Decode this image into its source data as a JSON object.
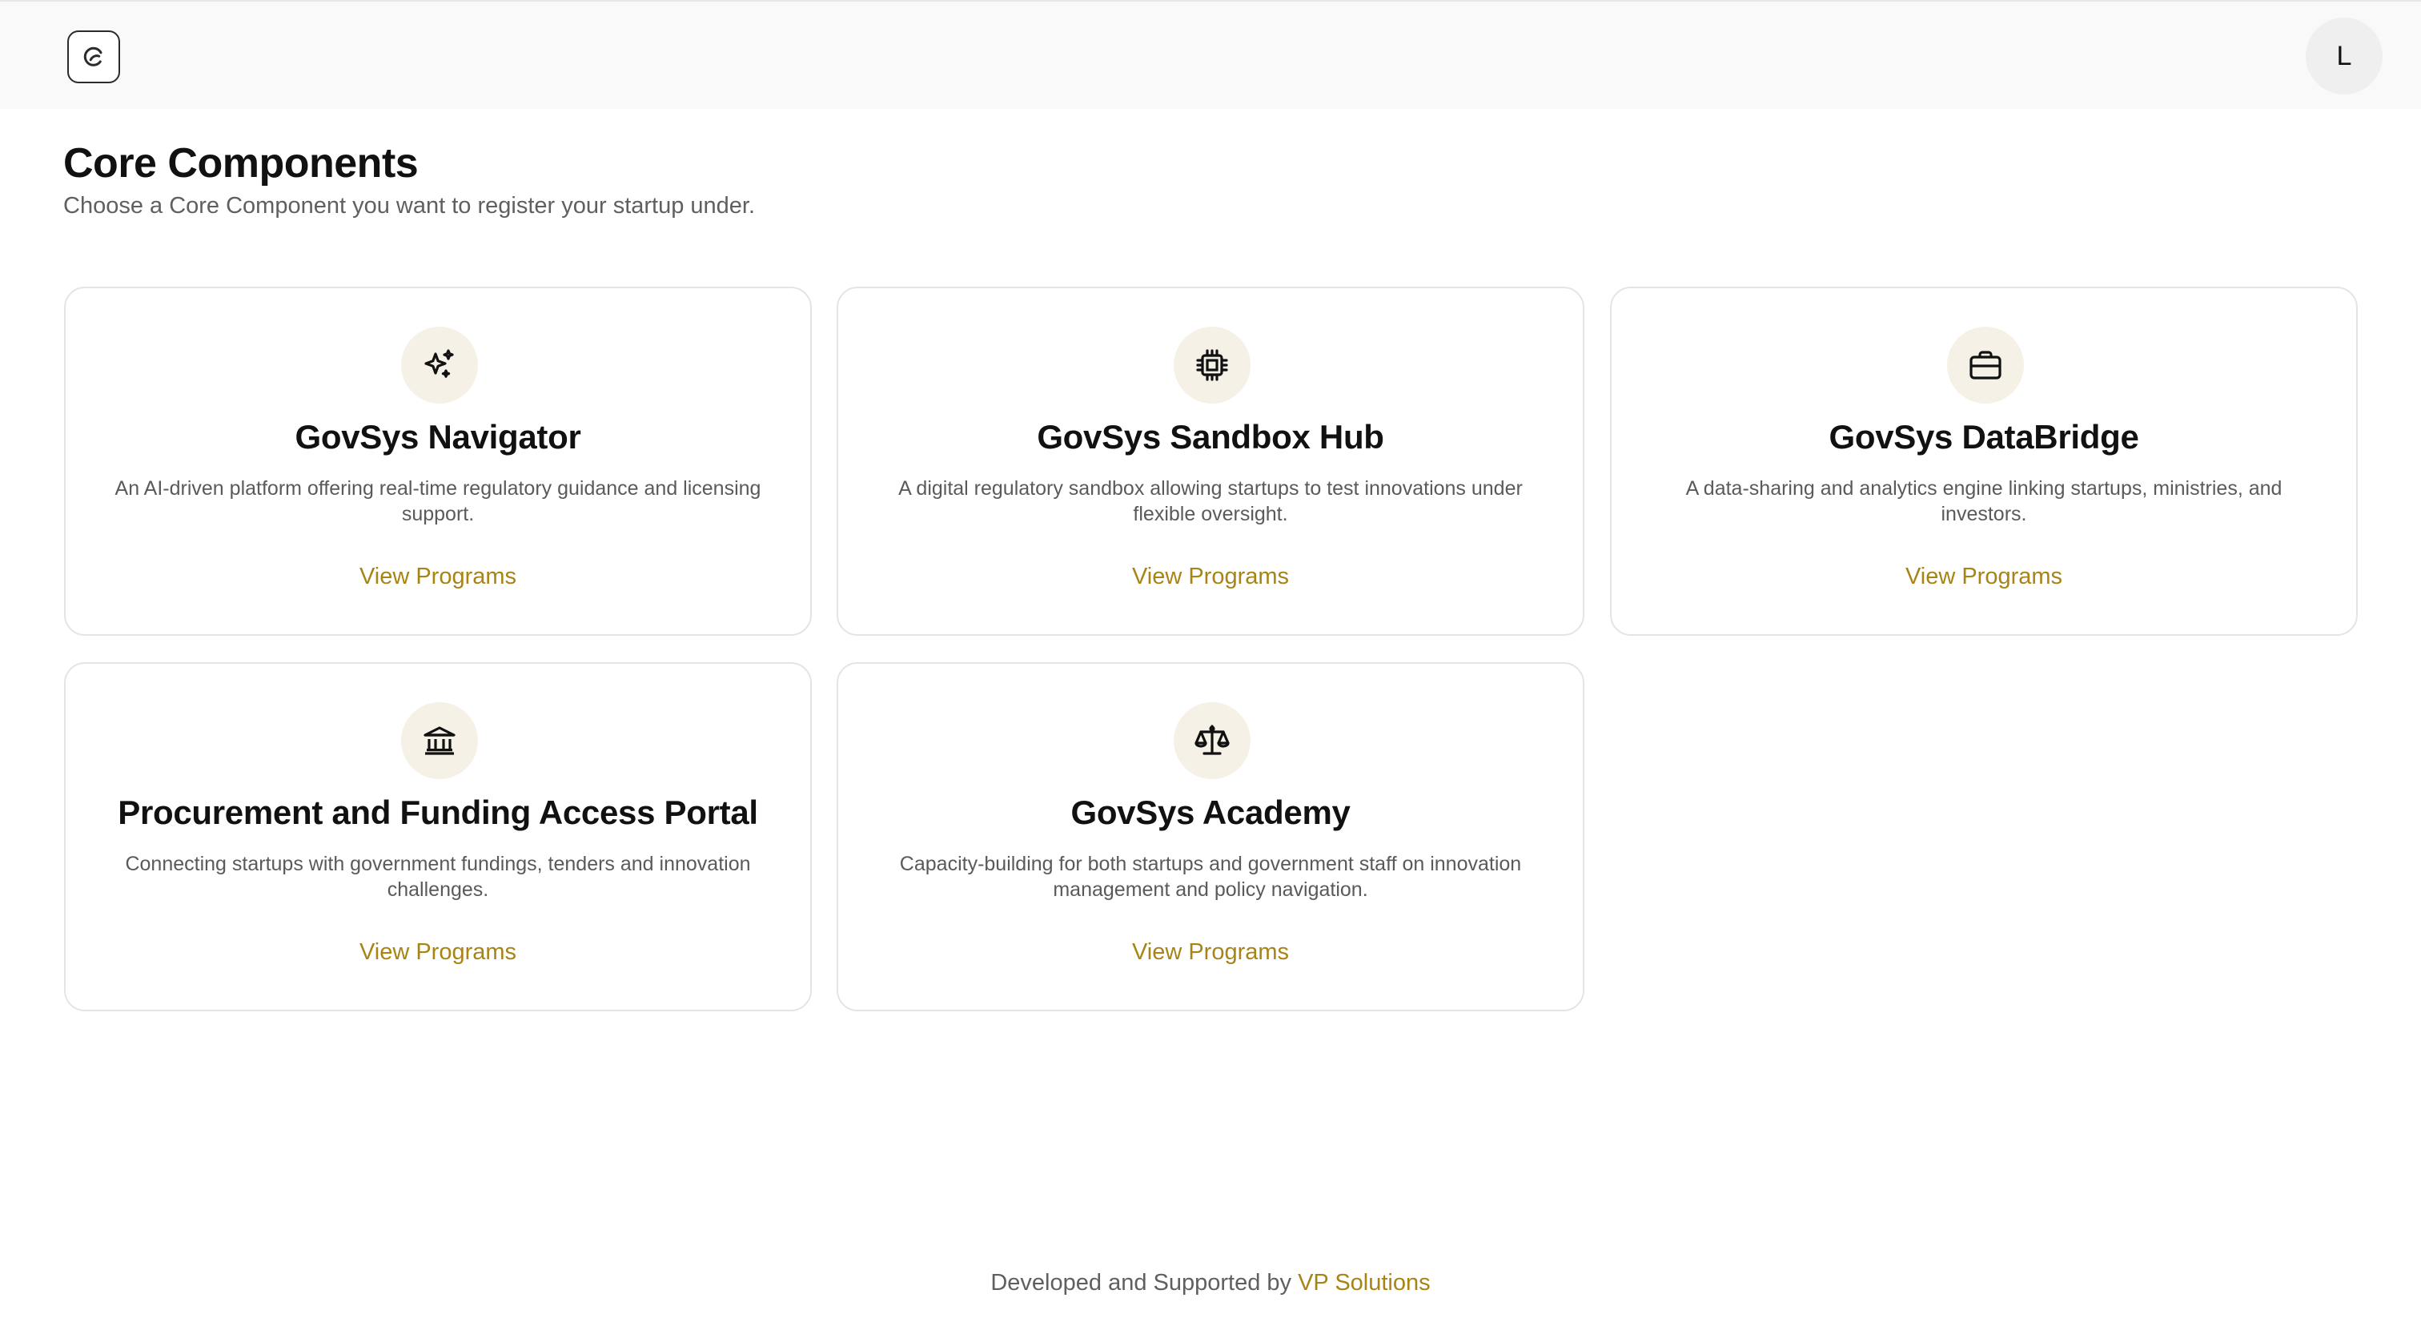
{
  "header": {
    "logo_icon": "app-logo-icon",
    "avatar_initial": "L"
  },
  "page": {
    "title": "Core Components",
    "subtitle": "Choose a Core Component you want to register your startup under."
  },
  "cards": [
    {
      "icon": "sparkles-icon",
      "title": "GovSys Navigator",
      "description": "An AI-driven platform offering real-time regulatory guidance and licensing support.",
      "link": "View Programs"
    },
    {
      "icon": "cpu-chip-icon",
      "title": "GovSys Sandbox Hub",
      "description": "A digital regulatory sandbox allowing startups to test innovations under flexible oversight.",
      "link": "View Programs"
    },
    {
      "icon": "briefcase-icon",
      "title": "GovSys DataBridge",
      "description": "A data-sharing and analytics engine linking startups, ministries, and investors.",
      "link": "View Programs"
    },
    {
      "icon": "bank-building-icon",
      "title": "Procurement and Funding Access Portal",
      "description": "Connecting startups with government fundings, tenders and innovation challenges.",
      "link": "View Programs"
    },
    {
      "icon": "scales-icon",
      "title": "GovSys Academy",
      "description": "Capacity-building for both startups and government staff on innovation management and policy navigation.",
      "link": "View Programs"
    }
  ],
  "footer": {
    "prefix": "Developed and Supported by",
    "brand": "VP Solutions"
  },
  "colors": {
    "accent": "#a88415",
    "icon_bg": "#f6f1e6",
    "header_bg": "#f9f9f9"
  }
}
